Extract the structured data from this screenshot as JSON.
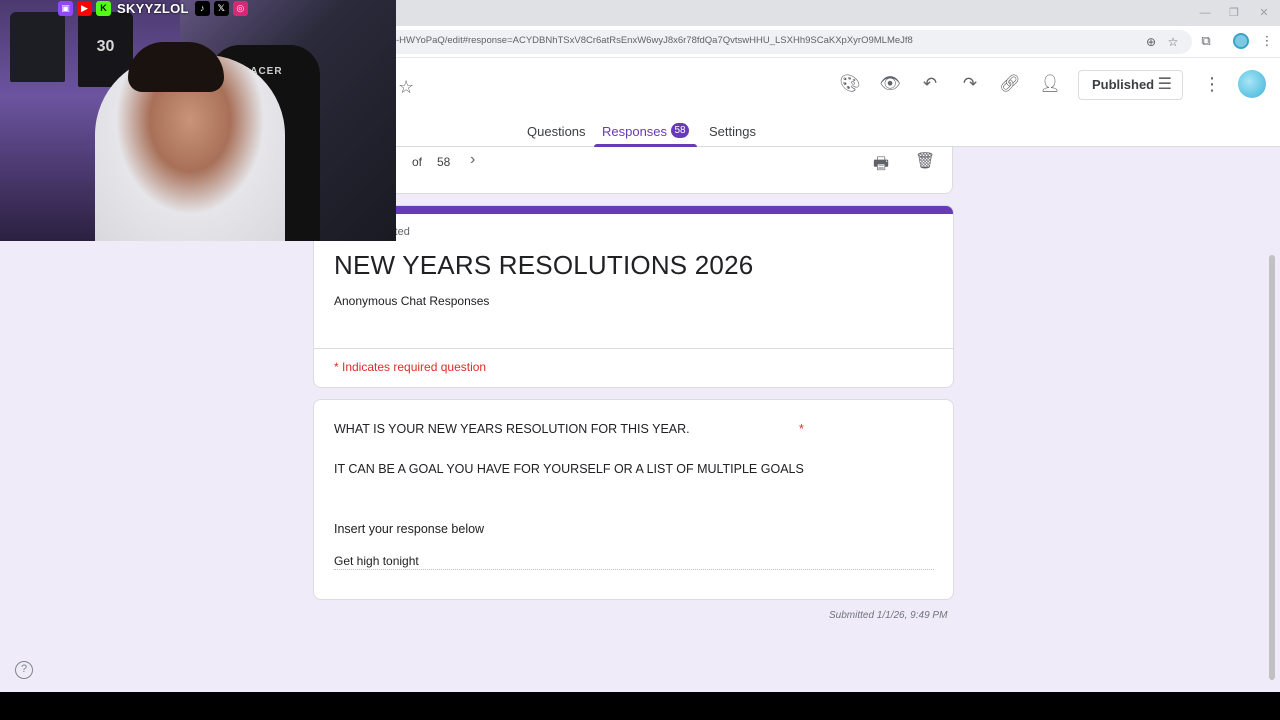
{
  "browser": {
    "url": "-HWYoPaQ/edit#response=ACYDBNhTSxV8Cr6atRsEnxW6wyJ8x6r78fdQa7QvtswHHU_LSXHh9SCaKXpXyrO9MLMeJf8"
  },
  "form_header": {
    "publish_label": "Published",
    "tabs": [
      {
        "label": "Questions"
      },
      {
        "label": "Responses",
        "badge": "58"
      },
      {
        "label": "Settings"
      }
    ]
  },
  "nav": {
    "of_label": "of",
    "total": "58"
  },
  "form": {
    "cannot_edit": "annot be edited",
    "title": "NEW YEARS RESOLUTIONS 2026",
    "description": "Anonymous Chat Responses",
    "required_note": "* Indicates required question"
  },
  "question": {
    "line1": "WHAT IS YOUR NEW YEARS RESOLUTION FOR THIS YEAR.",
    "required_star": "*",
    "line2": "IT CAN BE A GOAL YOU HAVE FOR YOURSELF OR A LIST OF MULTIPLE GOALS",
    "line3": "Insert your response below",
    "answer": "Get high tonight"
  },
  "submitted": "Submitted 1/1/26, 9:49 PM",
  "webcam": {
    "handle": "SKYYZLOL",
    "chair_text": "S-RACER",
    "jersey_number": "30"
  },
  "colors": {
    "accent": "#673ab7",
    "required": "#d93025",
    "page_bg": "#f0ebf8"
  }
}
